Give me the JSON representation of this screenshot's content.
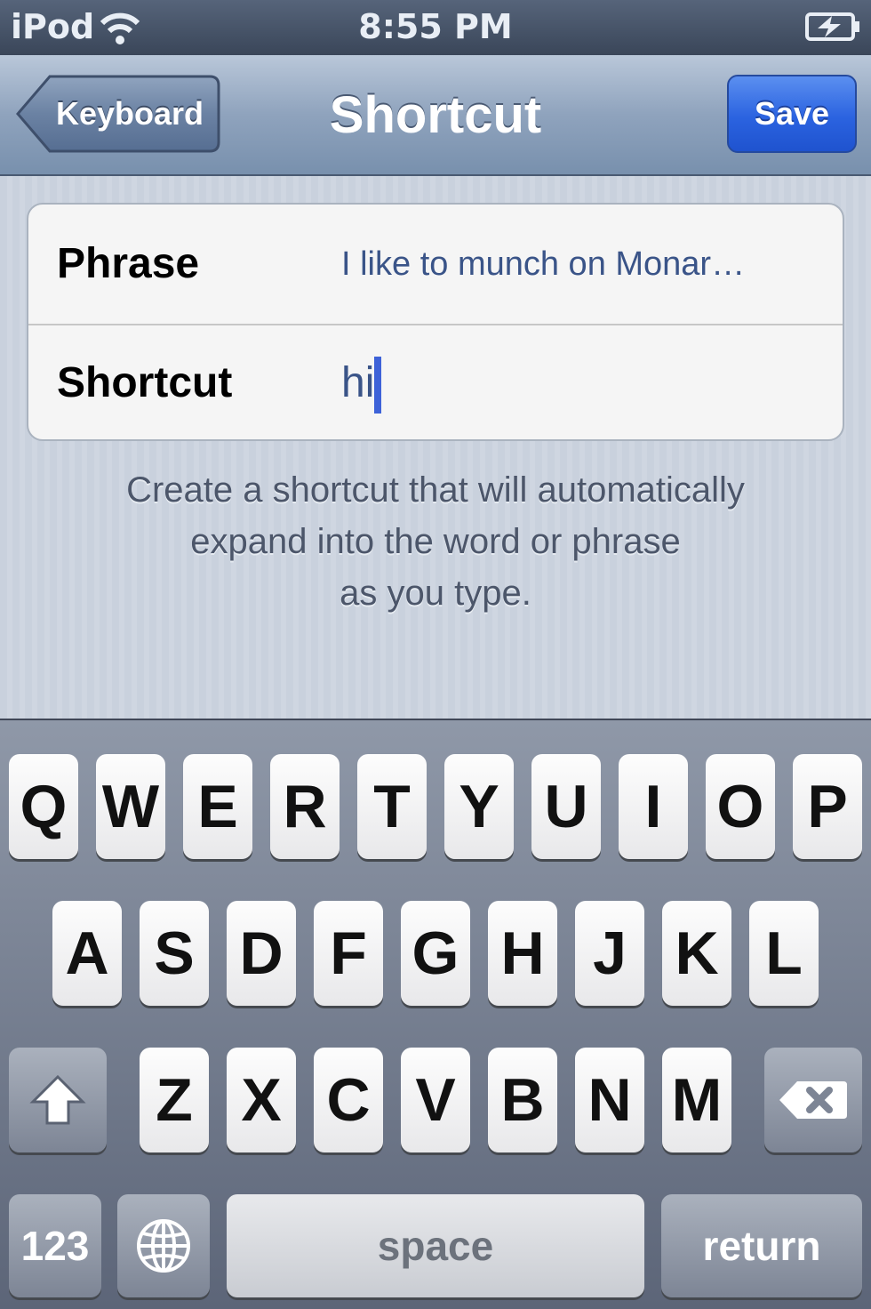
{
  "status_bar": {
    "carrier": "iPod",
    "time": "8:55 PM",
    "wifi_icon": "wifi-icon",
    "battery_icon": "battery-charging-icon"
  },
  "nav": {
    "back_label": "Keyboard",
    "title": "Shortcut",
    "save_label": "Save"
  },
  "form": {
    "phrase_label": "Phrase",
    "phrase_value": "I like to munch on Monar…",
    "shortcut_label": "Shortcut",
    "shortcut_value": "hi"
  },
  "footer": {
    "line1": "Create a shortcut that will automatically",
    "line2": "expand into the word or phrase",
    "line3": "as you type."
  },
  "keyboard": {
    "row1": [
      "Q",
      "W",
      "E",
      "R",
      "T",
      "Y",
      "U",
      "I",
      "O",
      "P"
    ],
    "row2": [
      "A",
      "S",
      "D",
      "F",
      "G",
      "H",
      "J",
      "K",
      "L"
    ],
    "row3": [
      "Z",
      "X",
      "C",
      "V",
      "B",
      "N",
      "M"
    ],
    "numbers_label": "123",
    "space_label": "space",
    "return_label": "return",
    "shift_icon": "shift-icon",
    "delete_icon": "delete-icon",
    "globe_icon": "globe-icon"
  }
}
